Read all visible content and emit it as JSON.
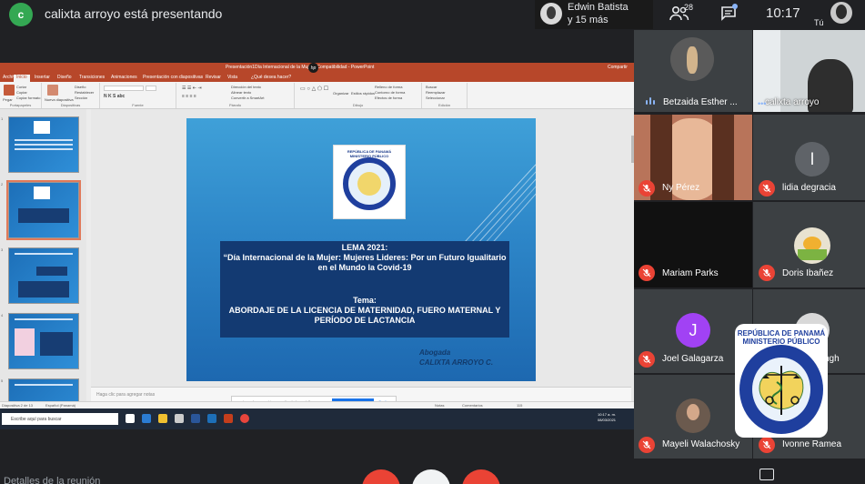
{
  "meeting": {
    "presenter_initial": "c",
    "presenter_banner": "calixta arroyo está presentando",
    "others_name": "Edwin Batista",
    "others_more": "y 15 más",
    "participant_count": "28",
    "time": "10:17",
    "self_label": "Tú"
  },
  "ppt": {
    "title": "Presentación1Día Internacional de la Mujer - Compatibilidad - PowerPoint",
    "hp": "hp",
    "share": "Compartir",
    "menu": [
      "Archivo",
      "Inicio",
      "Insertar",
      "Diseño",
      "Transiciones",
      "Animaciones",
      "Presentación con diapositivas",
      "Revisar",
      "Vista",
      "¿Qué desea hacer?"
    ],
    "ribbon_groups": [
      "Portapapeles",
      "Diapositivas",
      "Fuente",
      "Párrafo",
      "Dibujo",
      "Edición"
    ],
    "ribbon_buttons": {
      "pegar": "Pegar",
      "cortar": "Cortar",
      "copiar": "Copiar",
      "copiar_formato": "Copiar formato",
      "nueva": "Nueva diapositiva",
      "diseno": "Diseño",
      "restablecer": "Restablecer",
      "seccion": "Sección",
      "direccion": "Dirección del texto",
      "alinear": "Alinear texto",
      "smartart": "Convertir a SmartArt",
      "organizar": "Organizar",
      "estilos": "Estilos rápidos",
      "relleno": "Relleno de forma",
      "contorno": "Contorno de forma",
      "efectos": "Efectos de forma",
      "buscar": "Buscar",
      "reemplazar": "Reemplazar",
      "seleccionar": "Seleccionar"
    },
    "notes_placeholder": "Haga clic para agregar notas",
    "share_msg": "meet.google.com está compartiendo la pantalla.",
    "stop_share": "Dejar de compartir",
    "hide": "Ocultar",
    "status_slide": "Diapositiva 2 de 13",
    "status_lang": "Español (Panamá)",
    "status_notes": "Notas",
    "status_comments": "Comentarios",
    "zoom": "115",
    "taskbar_search": "Escribe aquí para buscar",
    "taskbar_time": "10:17 a. m.",
    "taskbar_date": "08/03/2021",
    "thumb_numbers": [
      "1",
      "2",
      "3",
      "4",
      "5"
    ]
  },
  "slide": {
    "logo_line1": "REPÚBLICA DE PANAMÁ",
    "logo_line2": "MINISTERIO PÚBLICO",
    "lema_title": "LEMA 2021:",
    "lema_text": "“Día Internacional de la Mujer: Mujeres Lideres: Por un Futuro Igualitario en el Mundo la Covid-19",
    "tema_title": "Tema:",
    "tema_text": "ABORDAJE DE LA LICENCIA DE MATERNIDAD, FUERO MATERNAL Y PERÍODO DE LACTANCIA",
    "author_role": "Abogada",
    "author_name": "CALIXTA ARROYO C."
  },
  "participants": [
    {
      "name": "Betzaida Esther ..."
    },
    {
      "name": "calixta arroyo"
    },
    {
      "name": "Ny Pérez"
    },
    {
      "name": "lidia degracia",
      "initial": "l"
    },
    {
      "name": "Mariam Parks"
    },
    {
      "name": "Doris Ibañez"
    },
    {
      "name": "Joel Galagarza",
      "initial": "J"
    },
    {
      "name": "ngh"
    },
    {
      "name": "Mayeli Walachosky"
    },
    {
      "name": "Ivonne Ramea"
    }
  ],
  "seal": {
    "line1": "REPÚBLICA DE PANAMÁ",
    "line2": "MINISTERIO PÚBLICO",
    "ring": "INSTITUTO DE MEDICINA LEGAL Y CIENCIAS FORENSES"
  },
  "bottom": {
    "left_text": "Detalles de la reunión"
  },
  "colors": {
    "meet_bg": "#202124",
    "tile_bg": "#3c4043",
    "mic_off": "#ea4335",
    "ppt_accent": "#b7472a",
    "accent_blue": "#8ab4f8"
  }
}
